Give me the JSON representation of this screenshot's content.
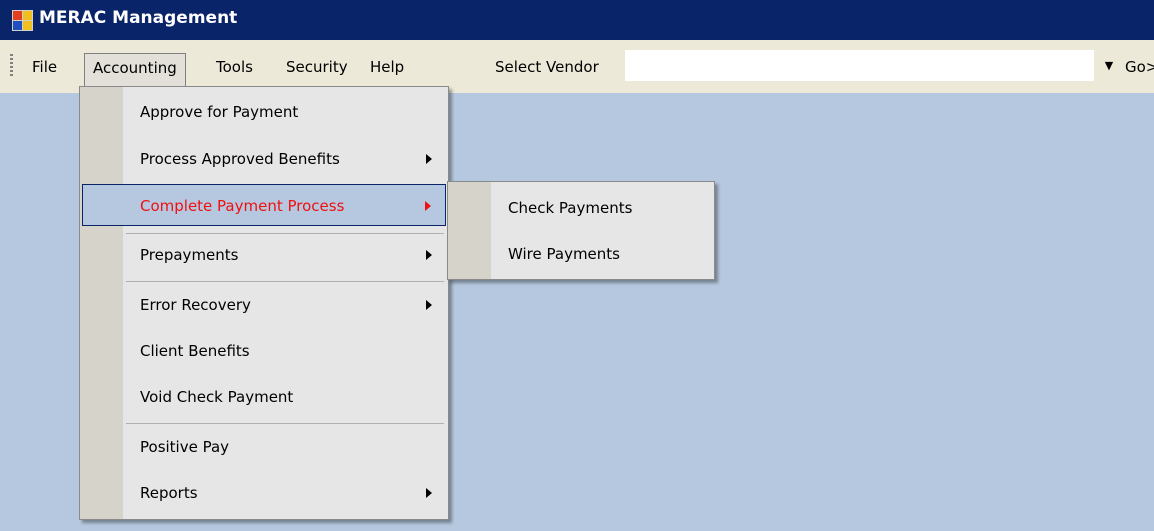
{
  "window": {
    "title": "MERAC Management",
    "icon": "app-window-icon"
  },
  "menubar": {
    "items": [
      "File",
      "Accounting",
      "Tools",
      "Security",
      "Help"
    ],
    "vendor_label": "Select Vendor",
    "vendor_value": "",
    "go_label": "Go>"
  },
  "accounting_menu": {
    "items": [
      {
        "label": "Approve for Payment",
        "submenu": false
      },
      {
        "label": "Process Approved Benefits",
        "submenu": true
      },
      {
        "label": "Complete Payment Process",
        "submenu": true,
        "highlighted": true
      },
      {
        "label": "Prepayments",
        "submenu": true
      },
      {
        "label": "Error Recovery",
        "submenu": true
      },
      {
        "label": "Client Benefits",
        "submenu": false
      },
      {
        "label": "Void Check Payment",
        "submenu": false
      },
      {
        "label": "Positive Pay",
        "submenu": false
      },
      {
        "label": "Reports",
        "submenu": true
      }
    ]
  },
  "complete_payment_submenu": {
    "items": [
      "Check Payments",
      "Wire Payments"
    ]
  },
  "colors": {
    "titlebar": "#0a246a",
    "desktop": "#b5c8df",
    "highlight_text": "#f01010"
  }
}
